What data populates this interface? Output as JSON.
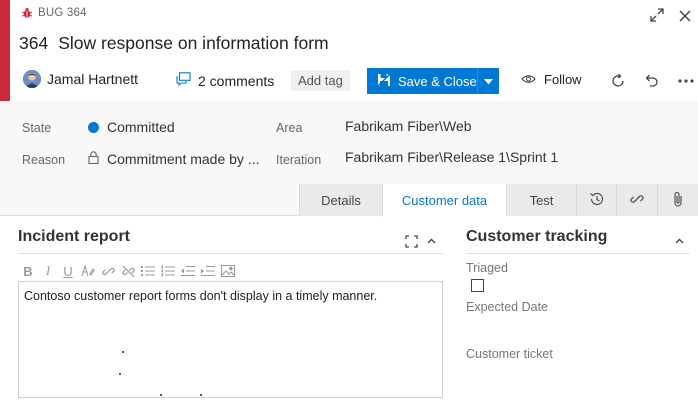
{
  "header": {
    "work_item_type": "BUG 364",
    "id": "364",
    "title": "Slow response on information form",
    "accent_color": "#cc293d"
  },
  "toolbar": {
    "assignee": "Jamal Hartnett",
    "comments": "2 comments",
    "add_tag": "Add tag",
    "save_close": "Save & Close",
    "follow": "Follow",
    "primary_color": "#0078d4"
  },
  "fields": {
    "state_label": "State",
    "state_value": "Committed",
    "reason_label": "Reason",
    "reason_value": "Commitment made by ...",
    "area_label": "Area",
    "area_value": "Fabrikam Fiber\\Web",
    "iteration_label": "Iteration",
    "iteration_value": "Fabrikam Fiber\\Release 1\\Sprint 1",
    "state_color": "#007acc"
  },
  "tabs": [
    {
      "label": "Details",
      "active": false
    },
    {
      "label": "Customer data",
      "active": true
    },
    {
      "label": "Test",
      "active": false
    }
  ],
  "tab_icons": [
    "history-icon",
    "link-icon",
    "attachment-icon"
  ],
  "incident": {
    "title": "Incident report",
    "text": "Contoso customer report forms don't display in a timely manner."
  },
  "tracking": {
    "title": "Customer tracking",
    "triaged_label": "Triaged",
    "expected_date_label": "Expected Date",
    "customer_ticket_label": "Customer ticket"
  }
}
